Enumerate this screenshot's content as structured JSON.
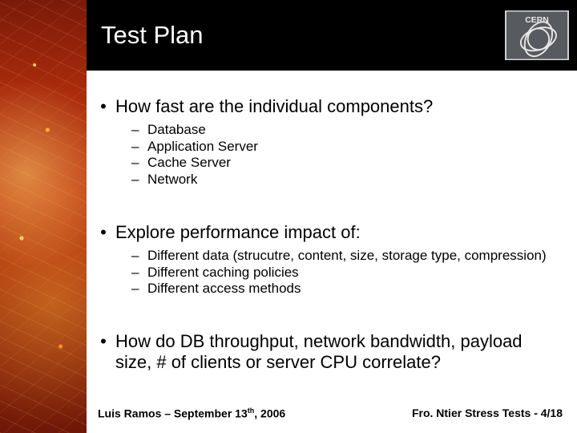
{
  "header": {
    "title": "Test Plan",
    "logo_label": "CERN"
  },
  "bullets": {
    "b1": {
      "text": "How fast are the individual components?",
      "sub": {
        "s1": "Database",
        "s2": "Application Server",
        "s3": "Cache Server",
        "s4": "Network"
      }
    },
    "b2": {
      "text": "Explore performance impact of:",
      "sub": {
        "s1": "Different data (strucutre, content, size, storage type, compression)",
        "s2": "Different caching policies",
        "s3": "Different access methods"
      }
    },
    "b3": {
      "text": "How do DB throughput, network bandwidth, payload size, # of clients or server CPU correlate?"
    }
  },
  "footer": {
    "left_pre": "Luis Ramos – September 13",
    "left_sup": "th",
    "left_post": ", 2006",
    "right": "Fro. Ntier Stress Tests - 4/18"
  }
}
